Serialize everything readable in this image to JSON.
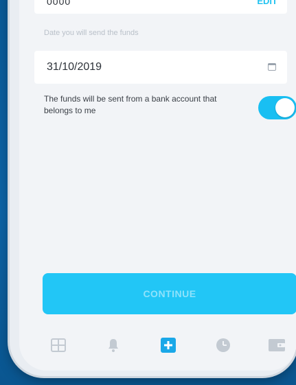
{
  "top_field": {
    "value": "0000",
    "action_label": "EDIT"
  },
  "date": {
    "label": "Date you will send the funds",
    "value": "31/10/2019",
    "icon": "calendar-icon"
  },
  "ownership": {
    "text": "The funds will be sent from a bank account that belongs to me",
    "toggle_on": true
  },
  "continue_button": {
    "label": "CONTINUE"
  },
  "tabbar": {
    "items": [
      {
        "icon": "dashboard-icon",
        "active": false
      },
      {
        "icon": "bell-icon",
        "active": false
      },
      {
        "icon": "plus-icon",
        "active": true
      },
      {
        "icon": "clock-icon",
        "active": false
      },
      {
        "icon": "wallet-icon",
        "active": false
      }
    ]
  },
  "colors": {
    "accent": "#22c6f6",
    "background": "#0b5e9c",
    "screen": "#f2f4f7"
  }
}
